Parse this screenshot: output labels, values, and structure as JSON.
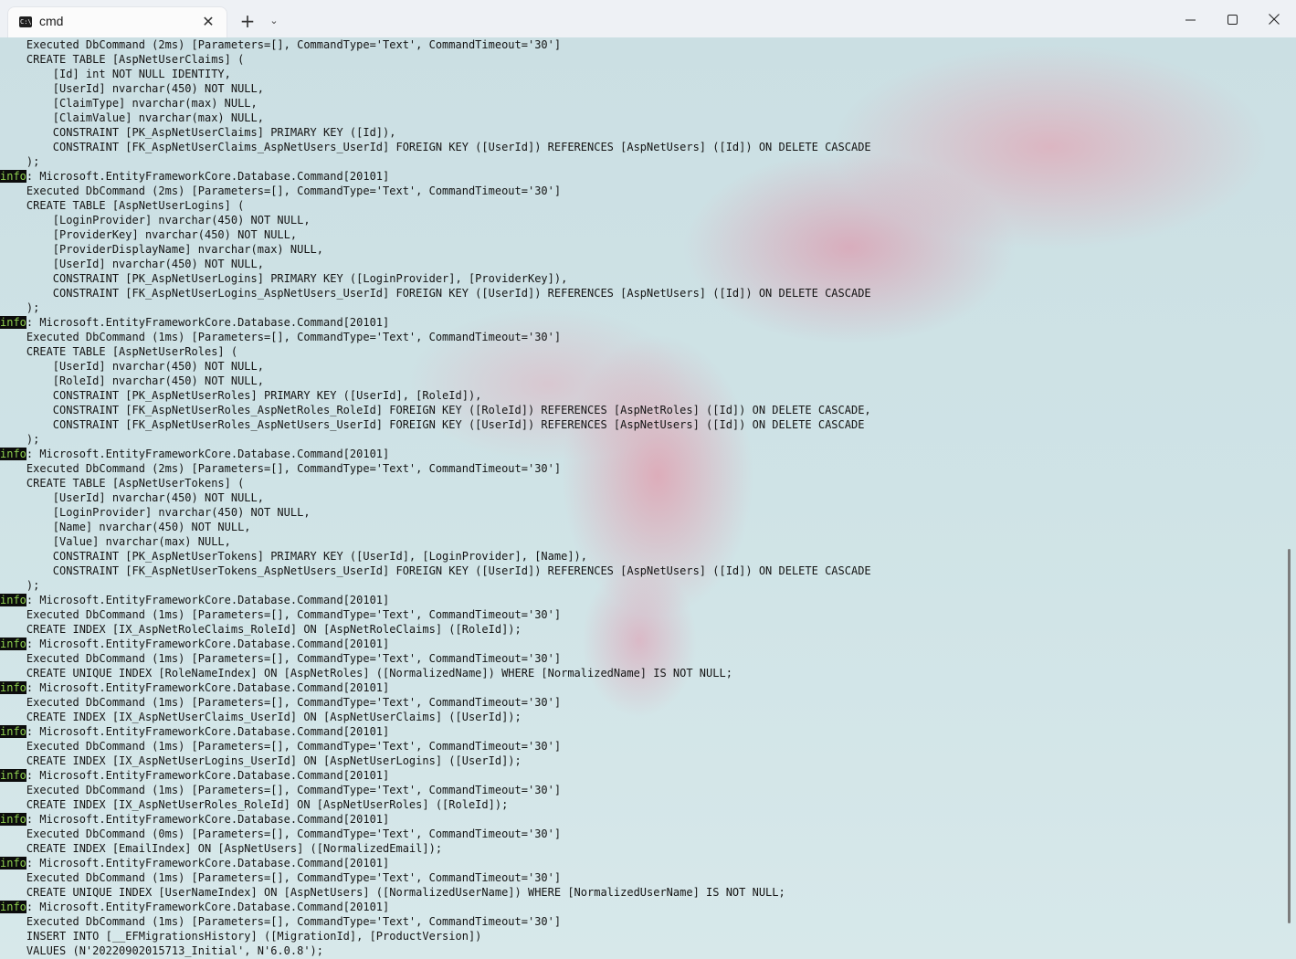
{
  "window": {
    "tab_title": "cmd",
    "tab_icon_text": "C:\\",
    "new_tab_symbol": "+",
    "dropdown_symbol": "⌄"
  },
  "terminal": {
    "info_badge": "info",
    "lines": [
      {
        "text": "    Executed DbCommand (2ms) [Parameters=[], CommandType='Text', CommandTimeout='30']"
      },
      {
        "text": "    CREATE TABLE [AspNetUserClaims] ("
      },
      {
        "text": "        [Id] int NOT NULL IDENTITY,"
      },
      {
        "text": "        [UserId] nvarchar(450) NOT NULL,"
      },
      {
        "text": "        [ClaimType] nvarchar(max) NULL,"
      },
      {
        "text": "        [ClaimValue] nvarchar(max) NULL,"
      },
      {
        "text": "        CONSTRAINT [PK_AspNetUserClaims] PRIMARY KEY ([Id]),"
      },
      {
        "text": "        CONSTRAINT [FK_AspNetUserClaims_AspNetUsers_UserId] FOREIGN KEY ([UserId]) REFERENCES [AspNetUsers] ([Id]) ON DELETE CASCADE"
      },
      {
        "text": "    );"
      },
      {
        "info": true,
        "text": ": Microsoft.EntityFrameworkCore.Database.Command[20101]"
      },
      {
        "text": "    Executed DbCommand (2ms) [Parameters=[], CommandType='Text', CommandTimeout='30']"
      },
      {
        "text": "    CREATE TABLE [AspNetUserLogins] ("
      },
      {
        "text": "        [LoginProvider] nvarchar(450) NOT NULL,"
      },
      {
        "text": "        [ProviderKey] nvarchar(450) NOT NULL,"
      },
      {
        "text": "        [ProviderDisplayName] nvarchar(max) NULL,"
      },
      {
        "text": "        [UserId] nvarchar(450) NOT NULL,"
      },
      {
        "text": "        CONSTRAINT [PK_AspNetUserLogins] PRIMARY KEY ([LoginProvider], [ProviderKey]),"
      },
      {
        "text": "        CONSTRAINT [FK_AspNetUserLogins_AspNetUsers_UserId] FOREIGN KEY ([UserId]) REFERENCES [AspNetUsers] ([Id]) ON DELETE CASCADE"
      },
      {
        "text": "    );"
      },
      {
        "info": true,
        "text": ": Microsoft.EntityFrameworkCore.Database.Command[20101]"
      },
      {
        "text": "    Executed DbCommand (1ms) [Parameters=[], CommandType='Text', CommandTimeout='30']"
      },
      {
        "text": "    CREATE TABLE [AspNetUserRoles] ("
      },
      {
        "text": "        [UserId] nvarchar(450) NOT NULL,"
      },
      {
        "text": "        [RoleId] nvarchar(450) NOT NULL,"
      },
      {
        "text": "        CONSTRAINT [PK_AspNetUserRoles] PRIMARY KEY ([UserId], [RoleId]),"
      },
      {
        "text": "        CONSTRAINT [FK_AspNetUserRoles_AspNetRoles_RoleId] FOREIGN KEY ([RoleId]) REFERENCES [AspNetRoles] ([Id]) ON DELETE CASCADE,"
      },
      {
        "text": "        CONSTRAINT [FK_AspNetUserRoles_AspNetUsers_UserId] FOREIGN KEY ([UserId]) REFERENCES [AspNetUsers] ([Id]) ON DELETE CASCADE"
      },
      {
        "text": "    );"
      },
      {
        "info": true,
        "text": ": Microsoft.EntityFrameworkCore.Database.Command[20101]"
      },
      {
        "text": "    Executed DbCommand (2ms) [Parameters=[], CommandType='Text', CommandTimeout='30']"
      },
      {
        "text": "    CREATE TABLE [AspNetUserTokens] ("
      },
      {
        "text": "        [UserId] nvarchar(450) NOT NULL,"
      },
      {
        "text": "        [LoginProvider] nvarchar(450) NOT NULL,"
      },
      {
        "text": "        [Name] nvarchar(450) NOT NULL,"
      },
      {
        "text": "        [Value] nvarchar(max) NULL,"
      },
      {
        "text": "        CONSTRAINT [PK_AspNetUserTokens] PRIMARY KEY ([UserId], [LoginProvider], [Name]),"
      },
      {
        "text": "        CONSTRAINT [FK_AspNetUserTokens_AspNetUsers_UserId] FOREIGN KEY ([UserId]) REFERENCES [AspNetUsers] ([Id]) ON DELETE CASCADE"
      },
      {
        "text": "    );"
      },
      {
        "info": true,
        "text": ": Microsoft.EntityFrameworkCore.Database.Command[20101]"
      },
      {
        "text": "    Executed DbCommand (1ms) [Parameters=[], CommandType='Text', CommandTimeout='30']"
      },
      {
        "text": "    CREATE INDEX [IX_AspNetRoleClaims_RoleId] ON [AspNetRoleClaims] ([RoleId]);"
      },
      {
        "info": true,
        "text": ": Microsoft.EntityFrameworkCore.Database.Command[20101]"
      },
      {
        "text": "    Executed DbCommand (1ms) [Parameters=[], CommandType='Text', CommandTimeout='30']"
      },
      {
        "text": "    CREATE UNIQUE INDEX [RoleNameIndex] ON [AspNetRoles] ([NormalizedName]) WHERE [NormalizedName] IS NOT NULL;"
      },
      {
        "info": true,
        "text": ": Microsoft.EntityFrameworkCore.Database.Command[20101]"
      },
      {
        "text": "    Executed DbCommand (1ms) [Parameters=[], CommandType='Text', CommandTimeout='30']"
      },
      {
        "text": "    CREATE INDEX [IX_AspNetUserClaims_UserId] ON [AspNetUserClaims] ([UserId]);"
      },
      {
        "info": true,
        "text": ": Microsoft.EntityFrameworkCore.Database.Command[20101]"
      },
      {
        "text": "    Executed DbCommand (1ms) [Parameters=[], CommandType='Text', CommandTimeout='30']"
      },
      {
        "text": "    CREATE INDEX [IX_AspNetUserLogins_UserId] ON [AspNetUserLogins] ([UserId]);"
      },
      {
        "info": true,
        "text": ": Microsoft.EntityFrameworkCore.Database.Command[20101]"
      },
      {
        "text": "    Executed DbCommand (1ms) [Parameters=[], CommandType='Text', CommandTimeout='30']"
      },
      {
        "text": "    CREATE INDEX [IX_AspNetUserRoles_RoleId] ON [AspNetUserRoles] ([RoleId]);"
      },
      {
        "info": true,
        "text": ": Microsoft.EntityFrameworkCore.Database.Command[20101]"
      },
      {
        "text": "    Executed DbCommand (0ms) [Parameters=[], CommandType='Text', CommandTimeout='30']"
      },
      {
        "text": "    CREATE INDEX [EmailIndex] ON [AspNetUsers] ([NormalizedEmail]);"
      },
      {
        "info": true,
        "text": ": Microsoft.EntityFrameworkCore.Database.Command[20101]"
      },
      {
        "text": "    Executed DbCommand (1ms) [Parameters=[], CommandType='Text', CommandTimeout='30']"
      },
      {
        "text": "    CREATE UNIQUE INDEX [UserNameIndex] ON [AspNetUsers] ([NormalizedUserName]) WHERE [NormalizedUserName] IS NOT NULL;"
      },
      {
        "info": true,
        "text": ": Microsoft.EntityFrameworkCore.Database.Command[20101]"
      },
      {
        "text": "    Executed DbCommand (1ms) [Parameters=[], CommandType='Text', CommandTimeout='30']"
      },
      {
        "text": "    INSERT INTO [__EFMigrationsHistory] ([MigrationId], [ProductVersion])"
      },
      {
        "text": "    VALUES (N'20220902015713_Initial', N'6.0.8');"
      }
    ]
  },
  "colors": {
    "info_badge_fg": "#8fd14f",
    "info_badge_bg": "#0c0c0c",
    "text": "#141414"
  }
}
